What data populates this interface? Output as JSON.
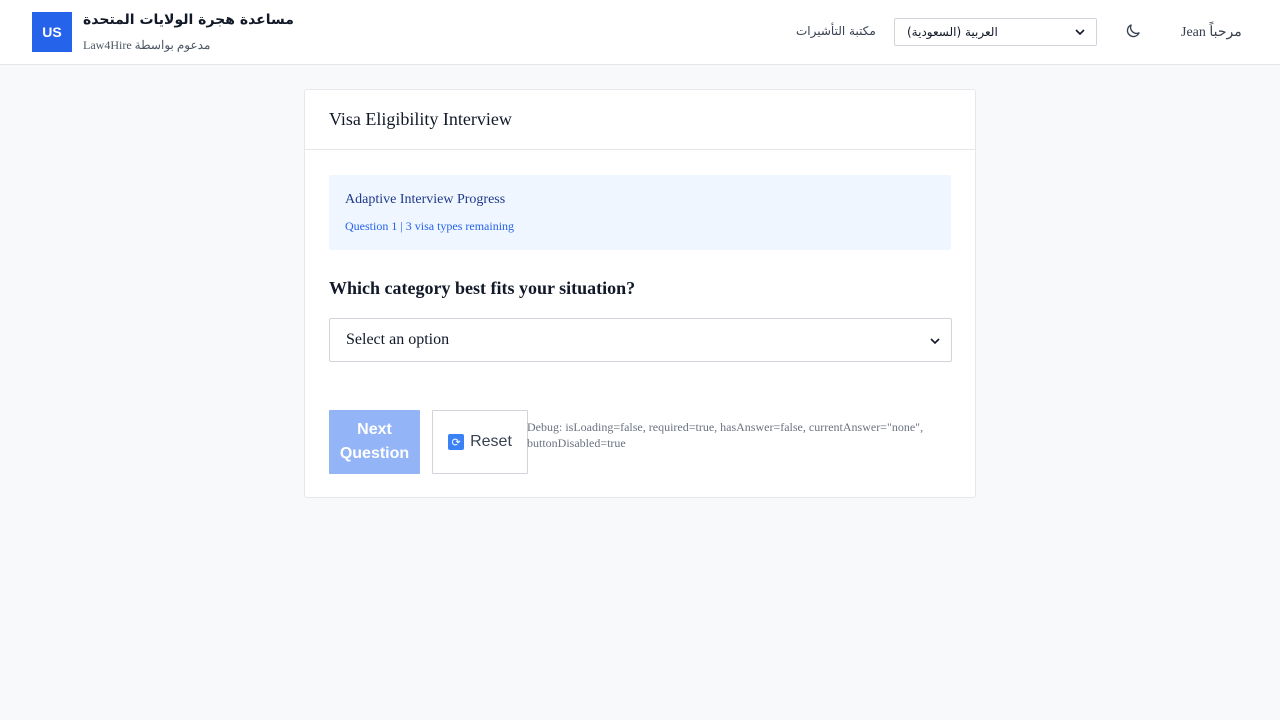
{
  "header": {
    "logo_text": "US",
    "app_title": "مساعدة هجرة الولايات المتحدة",
    "app_subtitle": "مدعوم بواسطة Law4Hire",
    "nav_visa_library": "مكتبة التأشيرات",
    "language_select_value": "العربية (السعودية)",
    "theme_icon": "moon-icon",
    "greeting": "مرحباً Jean"
  },
  "card": {
    "title": "Visa Eligibility Interview",
    "progress": {
      "title": "Adaptive Interview Progress",
      "subtitle": "Question 1 | 3 visa types remaining"
    },
    "question": "Which category best fits your situation?",
    "answer_select_value": "Select an option",
    "next_button_label": "Next Question",
    "reset_button_label": "Reset",
    "reset_icon": "refresh-icon",
    "debug_text": "Debug: isLoading=false, required=true, hasAnswer=false, currentAnswer=\"none\", buttonDisabled=true"
  },
  "colors": {
    "brand": "#2563eb",
    "progress_bg": "#eff6ff",
    "disabled_button": "#93b4f6"
  }
}
